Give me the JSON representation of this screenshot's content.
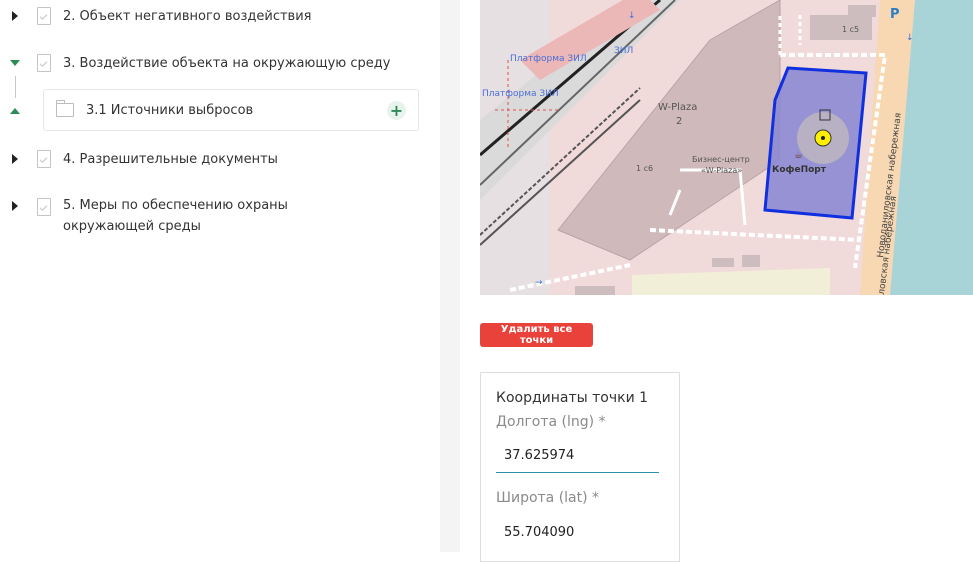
{
  "tree": {
    "items": [
      {
        "label": "2. Объект негативного воздействия"
      },
      {
        "label": "3. Воздействие объекта на окружающую среду"
      },
      {
        "label": "3.1 Источники выбросов"
      },
      {
        "label": "4. Разрешительные документы"
      },
      {
        "label": "5. Меры по обеспечению охраны окружающей среды"
      }
    ]
  },
  "map": {
    "labels": {
      "platform1": "Платформа ЗИЛ",
      "zil": "ЗИЛ",
      "platform2": "Платформа ЗИЛ",
      "wplaza": "W-Plaza",
      "wplaza_num": "2",
      "building_1c6": "1 с6",
      "biz1": "Бизнес-центр",
      "biz2": "«W-Plaza»",
      "cafe": "КофеПорт",
      "building_1c5": "1 с5",
      "embankment": "Новоданиловская набережная",
      "embankment2": "ловская набережная",
      "parking": "P"
    },
    "colors": {
      "polygon_stroke": "#1030e0",
      "polygon_fill": "#8c8ad2",
      "marker": "#ffef00"
    }
  },
  "actions": {
    "delete_all": "Удалить все точки"
  },
  "coords": {
    "title": "Координаты точки 1",
    "lng_label": "Долгота (lng) *",
    "lng_value": "37.625974",
    "lat_label": "Широта (lat) *",
    "lat_value": "55.704090"
  }
}
